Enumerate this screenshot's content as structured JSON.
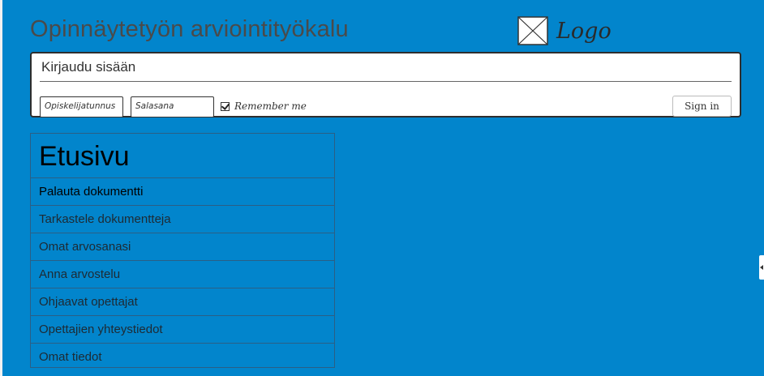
{
  "header": {
    "app_title": "Opinnäytetyön arviointityökalu",
    "logo_label": "Logo"
  },
  "login": {
    "heading": "Kirjaudu sisään",
    "username_placeholder": "Opiskelijatunnus",
    "password_placeholder": "Salasana",
    "remember_label": "Remember me",
    "remember_checked": true,
    "signin_label": "Sign in"
  },
  "nav": {
    "title": "Etusivu",
    "items": [
      {
        "label": "Palauta dokumentti",
        "active": true
      },
      {
        "label": "Tarkastele dokumentteja",
        "active": false
      },
      {
        "label": "Omat arvosanasi",
        "active": false
      },
      {
        "label": "Anna arvostelu",
        "active": false
      },
      {
        "label": "Ohjaavat opettajat",
        "active": false
      },
      {
        "label": "Opettajien yhteystiedot",
        "active": false
      },
      {
        "label": "Omat tiedot",
        "active": false
      }
    ]
  },
  "colors": {
    "background": "#0285cc",
    "panel": "#ffffff",
    "text_dark": "#4a4a4a"
  },
  "icons": {
    "logo": "image-placeholder-icon",
    "remember": "checkbox-checked-icon",
    "side_handle": "chevron-left-icon"
  }
}
